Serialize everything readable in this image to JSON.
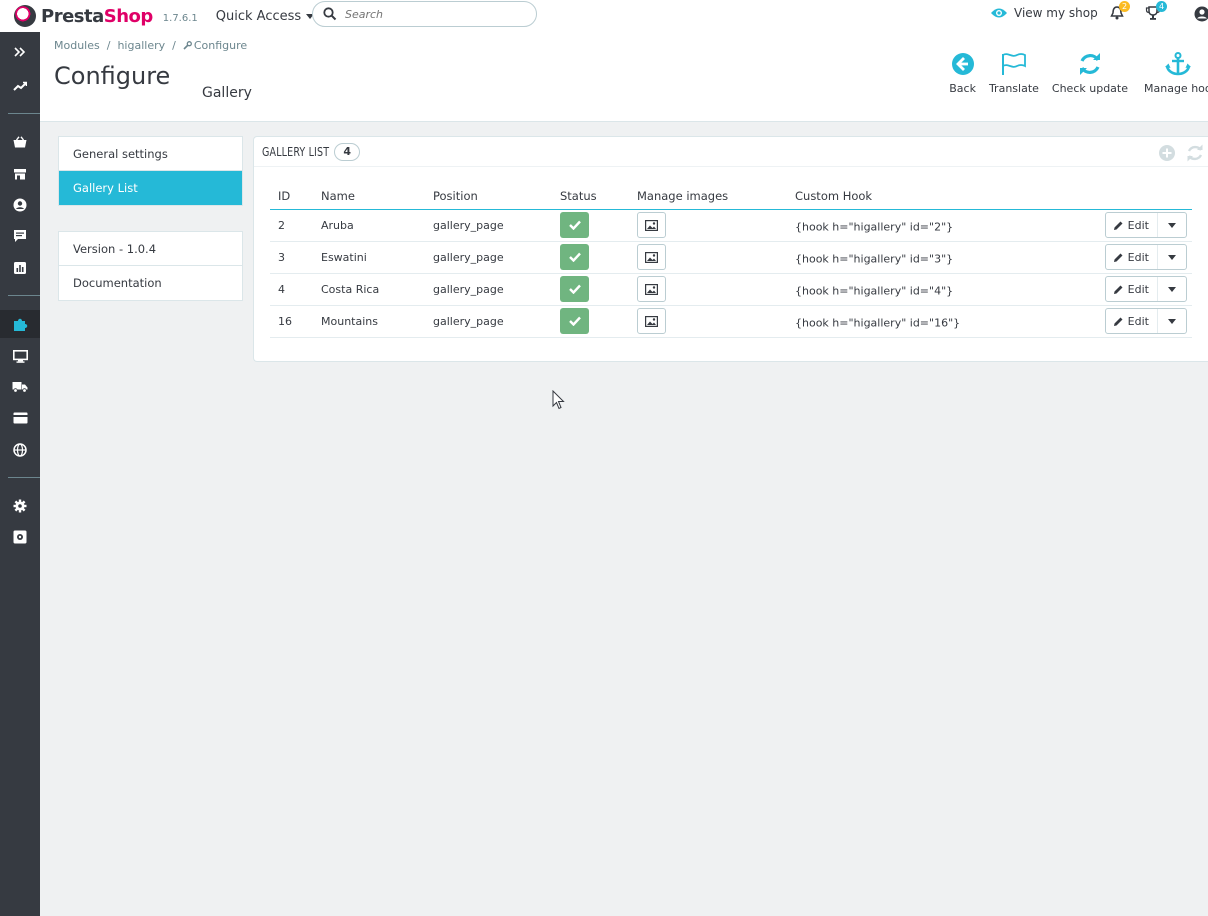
{
  "brand": {
    "name_part1": "Presta",
    "name_part2": "Shop",
    "version": "1.7.6.1"
  },
  "topbar": {
    "quick_access": "Quick Access",
    "search_placeholder": "Search",
    "view_shop": "View my shop",
    "notifications_count": "2",
    "trophy_count": "4"
  },
  "breadcrumb": {
    "items": [
      "Modules",
      "higallery",
      "Configure"
    ]
  },
  "page": {
    "title": "Configure",
    "subtitle": "Gallery"
  },
  "toolbar": {
    "back": "Back",
    "translate": "Translate",
    "check_update": "Check update",
    "manage_hooks": "Manage hooks"
  },
  "menu": {
    "items": [
      "General settings",
      "Gallery List"
    ],
    "info": [
      "Version - 1.0.4",
      "Documentation"
    ]
  },
  "panel": {
    "title": "GALLERY LIST",
    "count": "4"
  },
  "table": {
    "columns": [
      "ID",
      "Name",
      "Position",
      "Status",
      "Manage images",
      "Custom Hook"
    ],
    "rows": [
      {
        "id": "2",
        "name": "Aruba",
        "position": "gallery_page",
        "hook": "{hook h=\"higallery\" id=\"2\"}",
        "edit": "Edit"
      },
      {
        "id": "3",
        "name": "Eswatini",
        "position": "gallery_page",
        "hook": "{hook h=\"higallery\" id=\"3\"}",
        "edit": "Edit"
      },
      {
        "id": "4",
        "name": "Costa Rica",
        "position": "gallery_page",
        "hook": "{hook h=\"higallery\" id=\"4\"}",
        "edit": "Edit"
      },
      {
        "id": "16",
        "name": "Mountains",
        "position": "gallery_page",
        "hook": "{hook h=\"higallery\" id=\"16\"}",
        "edit": "Edit"
      }
    ]
  },
  "colors": {
    "accent": "#25b9d7",
    "brand_pink": "#df0067",
    "sidebar": "#363a41",
    "status_green": "#70b580"
  }
}
